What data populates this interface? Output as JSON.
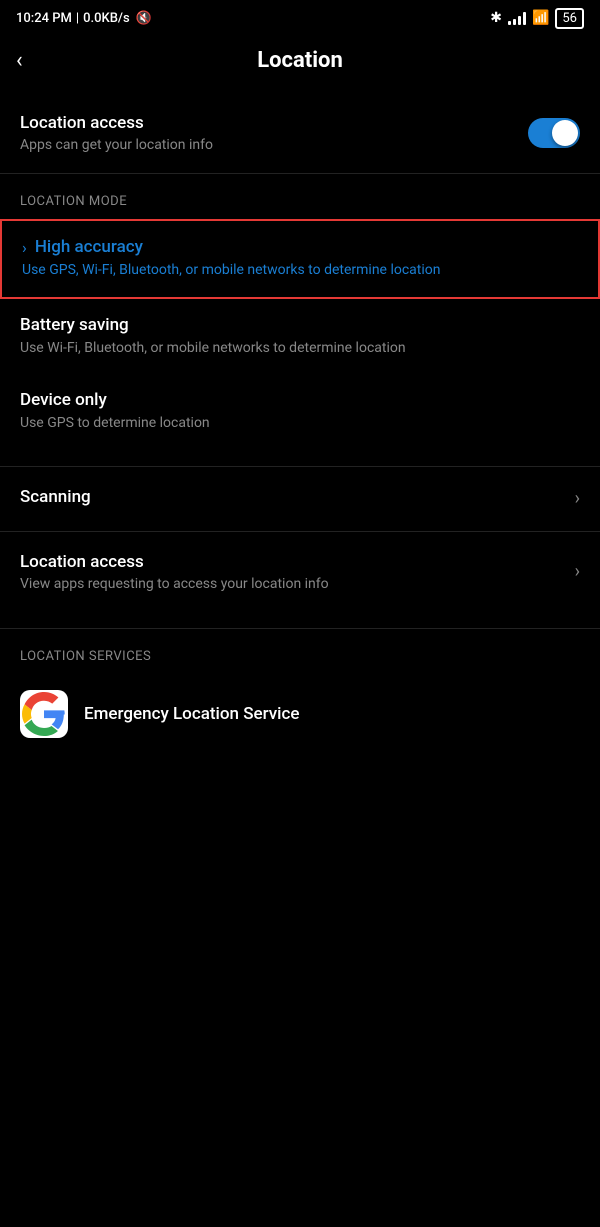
{
  "statusBar": {
    "time": "10:24 PM",
    "network": "0.0KB/s",
    "battery": "56"
  },
  "header": {
    "title": "Location",
    "back_label": "<"
  },
  "locationAccess": {
    "label": "Location access",
    "description": "Apps can get your location info",
    "toggle_state": true
  },
  "locationMode": {
    "section_label": "LOCATION MODE",
    "modes": [
      {
        "id": "high-accuracy",
        "title": "High accuracy",
        "description": "Use GPS, Wi-Fi, Bluetooth, or mobile networks to determine location",
        "highlighted": true,
        "color": "blue"
      },
      {
        "id": "battery-saving",
        "title": "Battery saving",
        "description": "Use Wi-Fi, Bluetooth, or mobile networks to determine location",
        "highlighted": false,
        "color": "white"
      },
      {
        "id": "device-only",
        "title": "Device only",
        "description": "Use GPS to determine location",
        "highlighted": false,
        "color": "white"
      }
    ]
  },
  "navItems": [
    {
      "id": "scanning",
      "label": "Scanning",
      "description": ""
    },
    {
      "id": "location-access",
      "label": "Location access",
      "description": "View apps requesting to access your location info"
    }
  ],
  "locationServices": {
    "section_label": "LOCATION SERVICES",
    "services": [
      {
        "id": "emergency-location",
        "label": "Emergency Location Service",
        "icon": "google"
      }
    ]
  }
}
